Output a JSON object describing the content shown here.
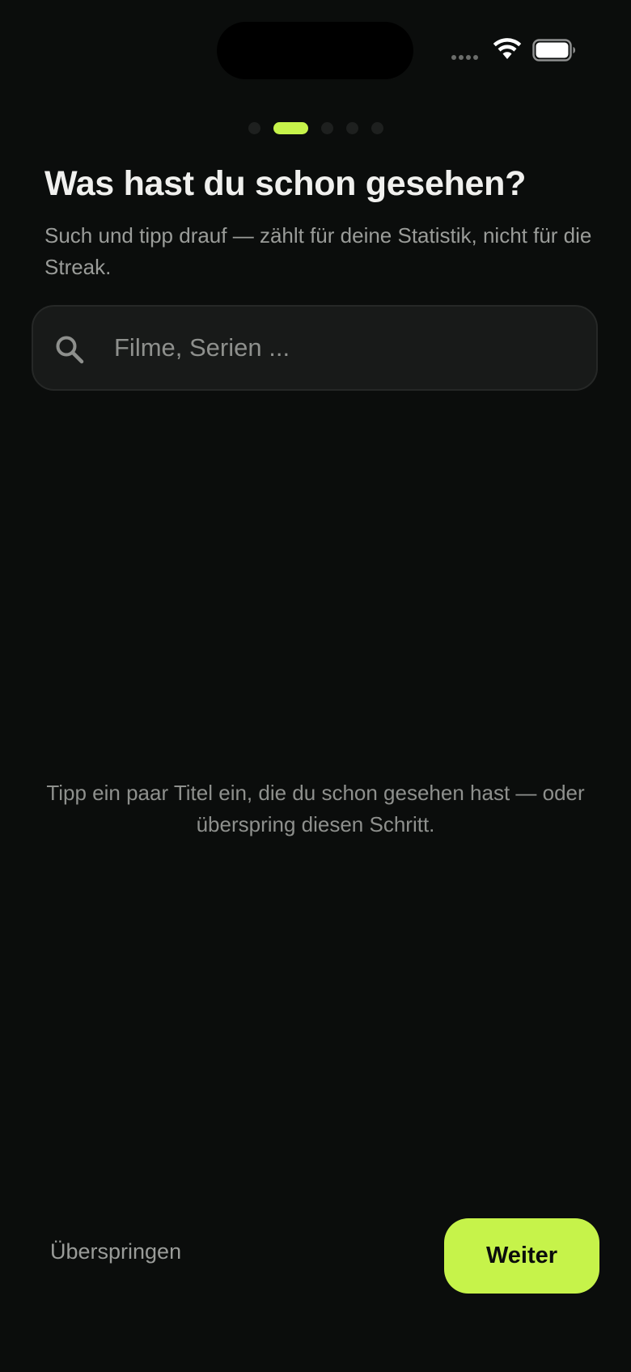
{
  "status_bar": {
    "wifi_icon": "wifi-icon",
    "battery_icon": "battery-icon",
    "signal_icon": "cellular-signal-dots"
  },
  "pager": {
    "total_steps": 5,
    "current_step": 2,
    "active_color": "#c6f34a",
    "inactive_color": "#1e201f"
  },
  "header": {
    "title": "Was hast du schon gesehen?",
    "subtitle": "Such und tipp drauf — zählt für deine Statistik, nicht für die Streak."
  },
  "search": {
    "icon": "search-icon",
    "value": "",
    "placeholder": "Filme, Serien ..."
  },
  "empty_state": {
    "text": "Tipp ein paar Titel ein, die du schon gesehen hast — oder überspring diesen Schritt."
  },
  "footer": {
    "skip_label": "Überspringen",
    "next_label": "Weiter"
  },
  "colors": {
    "background": "#0b0d0c",
    "accent": "#c6f34a",
    "text_primary": "#f0f0ee",
    "text_secondary": "#9a9c99"
  }
}
